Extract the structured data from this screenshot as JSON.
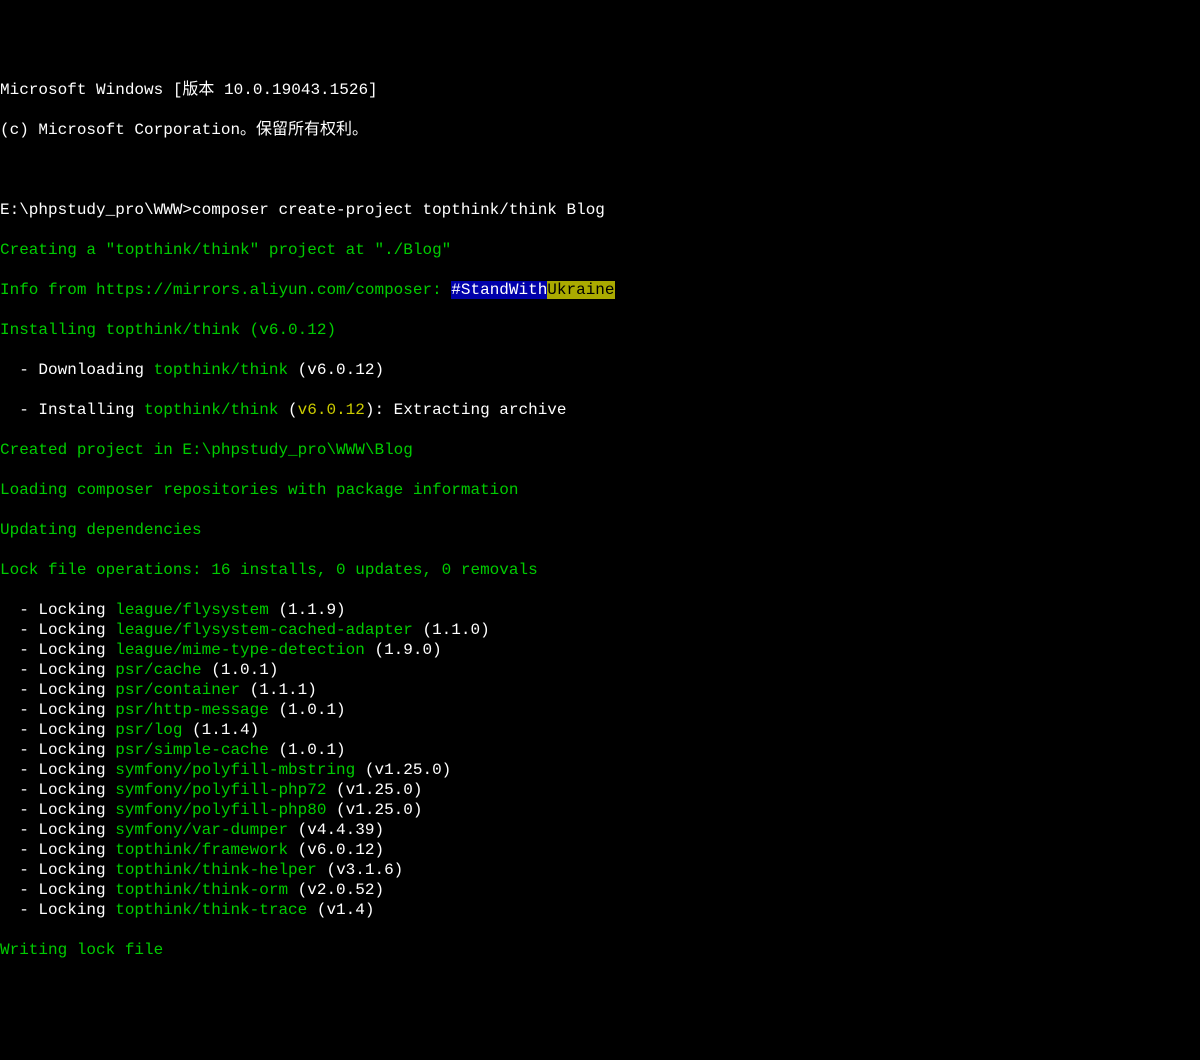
{
  "header1": "Microsoft Windows [版本 10.0.19043.1526]",
  "header2": "(c) Microsoft Corporation。保留所有权利。",
  "prompt": "E:\\phpstudy_pro\\WWW>",
  "command": "composer create-project topthink/think Blog",
  "creating": "Creating a \"topthink/think\" project at \"./Blog\"",
  "info_prefix": "Info from https://mirrors.aliyun.com/composer: ",
  "stand": "#StandWith",
  "ukraine": "Ukraine",
  "installing_header": "Installing topthink/think (v6.0.12)",
  "dl_prefix": "  - Downloading ",
  "dl_pkg": "topthink/think",
  "dl_ver": " (v6.0.12)",
  "inst_prefix": "  - Installing ",
  "inst_pkg": "topthink/think",
  "inst_ver_open": " (",
  "inst_ver": "v6.0.12",
  "inst_ver_close": "): Extracting archive",
  "created": "Created project in E:\\phpstudy_pro\\WWW\\Blog",
  "loading": "Loading composer repositories with package information",
  "updating": "Updating dependencies",
  "lockops": "Lock file operations: 16 installs, 0 updates, 0 removals",
  "lock_prefix": "  - Locking ",
  "packages": [
    {
      "name": "league/flysystem",
      "ver": " (1.1.9)"
    },
    {
      "name": "league/flysystem-cached-adapter",
      "ver": " (1.1.0)"
    },
    {
      "name": "league/mime-type-detection",
      "ver": " (1.9.0)"
    },
    {
      "name": "psr/cache",
      "ver": " (1.0.1)"
    },
    {
      "name": "psr/container",
      "ver": " (1.1.1)"
    },
    {
      "name": "psr/http-message",
      "ver": " (1.0.1)"
    },
    {
      "name": "psr/log",
      "ver": " (1.1.4)"
    },
    {
      "name": "psr/simple-cache",
      "ver": " (1.0.1)"
    },
    {
      "name": "symfony/polyfill-mbstring",
      "ver": " (v1.25.0)"
    },
    {
      "name": "symfony/polyfill-php72",
      "ver": " (v1.25.0)"
    },
    {
      "name": "symfony/polyfill-php80",
      "ver": " (v1.25.0)"
    },
    {
      "name": "symfony/var-dumper",
      "ver": " (v4.4.39)"
    },
    {
      "name": "topthink/framework",
      "ver": " (v6.0.12)"
    },
    {
      "name": "topthink/think-helper",
      "ver": " (v3.1.6)"
    },
    {
      "name": "topthink/think-orm",
      "ver": " (v2.0.52)"
    },
    {
      "name": "topthink/think-trace",
      "ver": " (v1.4)"
    }
  ],
  "writing": "Writing lock file"
}
